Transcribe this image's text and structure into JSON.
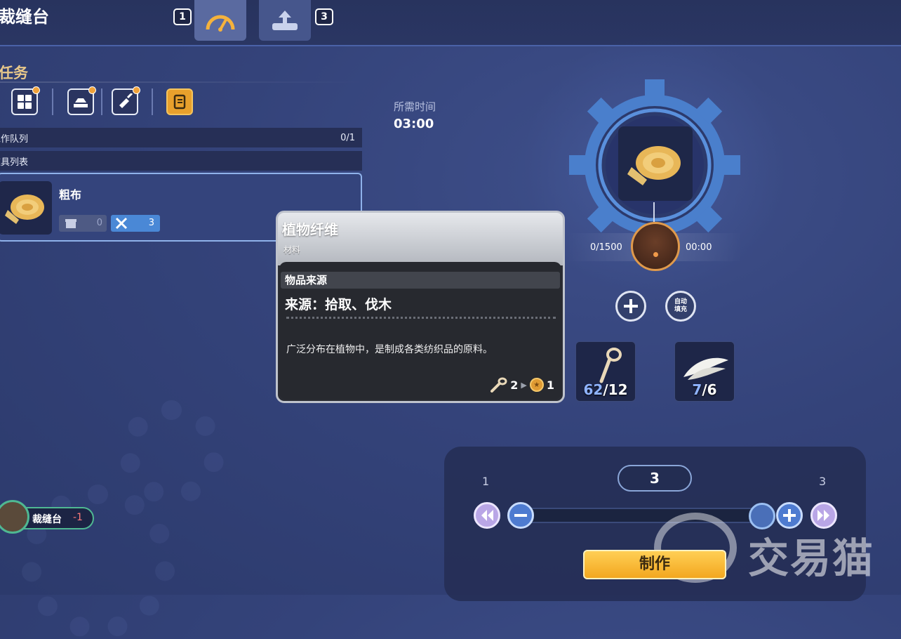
{
  "header": {
    "title": "裁缝台",
    "left_key": "1",
    "right_key": "3",
    "tabs": [
      {
        "icon": "gauge-icon",
        "active": true
      },
      {
        "icon": "upload-icon",
        "active": false
      }
    ]
  },
  "task_panel": {
    "title": "任务",
    "filters": [
      {
        "icon": "grid-icon",
        "notify": true
      },
      {
        "icon": "ingot-icon",
        "notify": true
      },
      {
        "icon": "syringe-icon",
        "notify": true
      },
      {
        "icon": "scroll-icon",
        "notify": false,
        "active": true
      }
    ],
    "work_queue": {
      "label": "工作队列",
      "value": "0/1"
    },
    "item_list_label": "道具列表",
    "recipe": {
      "name": "粗布",
      "stock": "0",
      "tools": "3"
    }
  },
  "tooltip": {
    "name": "植物纤维",
    "type": "材料",
    "source_header": "物品来源",
    "source": "来源：拾取、伐木",
    "description": "广泛分布在植物中，是制成各类纺织品的原料。",
    "cost_qty": "2",
    "coin_value": "1"
  },
  "crafting": {
    "time_label": "所需时间",
    "time_value": "03:00",
    "progress_left": "0/1500",
    "progress_right": "00:00",
    "auto_fill_label": "自动填充",
    "materials": [
      {
        "icon": "fiber-icon",
        "have": "62",
        "need": "12"
      },
      {
        "icon": "feather-icon",
        "have": "7",
        "need": "6"
      }
    ]
  },
  "quantity": {
    "min": "1",
    "max": "3",
    "value": "3",
    "slider_fraction": 1.0
  },
  "craft_button": "制作",
  "station": {
    "name": "裁缝台",
    "count": "-1"
  },
  "watermark": "交易猫",
  "colors": {
    "accent_orange": "#f3a71f",
    "panel_blue": "#34447c",
    "gear_blue": "#4a7fcc"
  }
}
